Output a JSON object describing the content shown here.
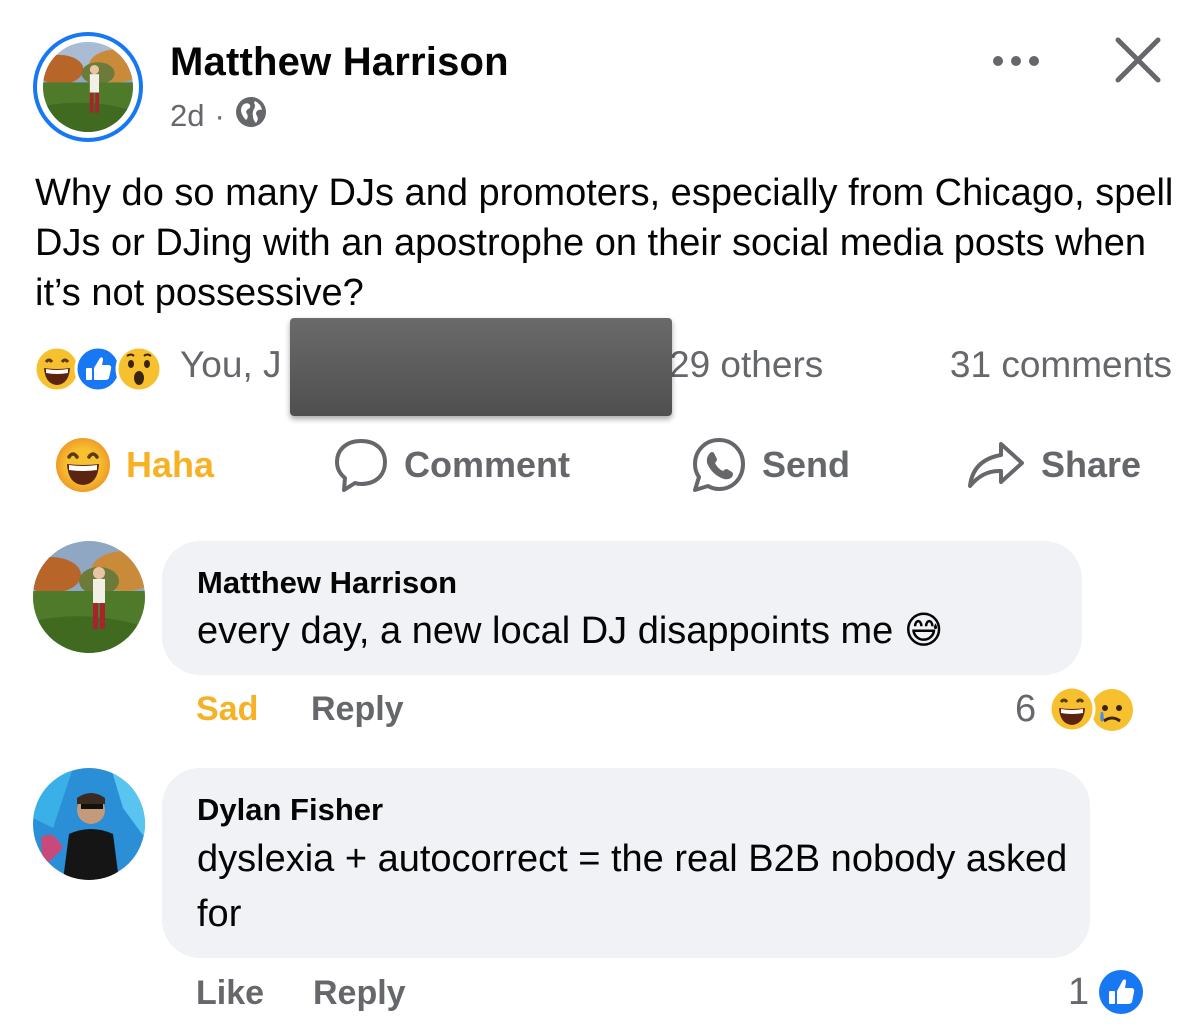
{
  "post": {
    "author": "Matthew Harrison",
    "time": "2d",
    "separator": "·",
    "text": "Why do so many DJs and promoters, especially from Chicago, spell DJs or DJing with an apostrophe on their social media posts when it’s not possessive?"
  },
  "reactions": {
    "names_visible": "You, J",
    "others": "29 others",
    "comments": "31 comments",
    "icons": [
      "haha-emoji-icon",
      "like-icon",
      "wow-emoji-icon"
    ]
  },
  "actions": {
    "haha": "Haha",
    "comment": "Comment",
    "send": "Send",
    "share": "Share"
  },
  "comments": [
    {
      "author": "Matthew Harrison",
      "text": "every day, a new local DJ disappoints me 😅",
      "reaction_label": "Sad",
      "reply_label": "Reply",
      "count": "6"
    },
    {
      "author": "Dylan Fisher",
      "text": "dyslexia + autocorrect = the real B2B nobody asked for",
      "reaction_label": "Like",
      "reply_label": "Reply",
      "count": "1"
    }
  ],
  "colors": {
    "accent": "#1877f2",
    "haha": "#f7b125",
    "secondary_text": "#65676b",
    "bubble": "#f0f2f5"
  }
}
